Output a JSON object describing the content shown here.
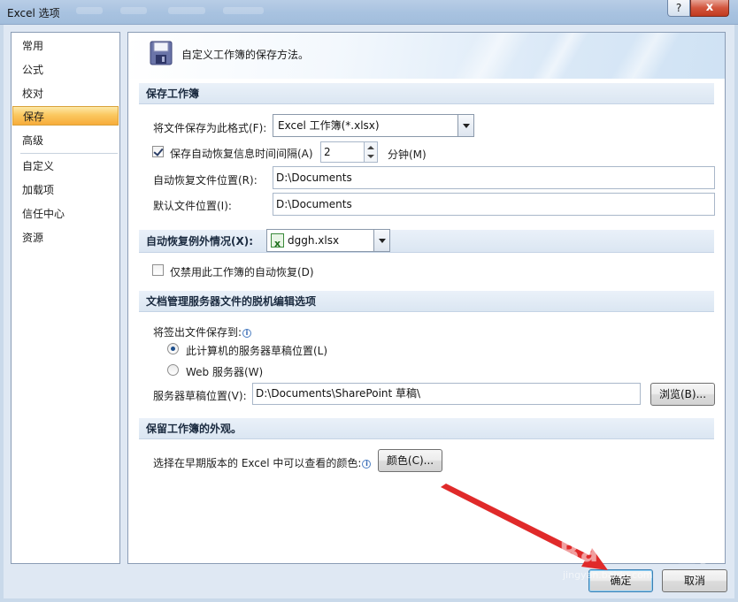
{
  "window": {
    "title": "Excel 选项",
    "help_label": "?",
    "close_label": "x"
  },
  "nav": {
    "items": [
      {
        "label": "常用"
      },
      {
        "label": "公式"
      },
      {
        "label": "校对"
      },
      {
        "label": "保存"
      },
      {
        "label": "高级"
      },
      {
        "label": "自定义"
      },
      {
        "label": "加载项"
      },
      {
        "label": "信任中心"
      },
      {
        "label": "资源"
      }
    ],
    "selected": "保存"
  },
  "banner": {
    "text": "自定义工作簿的保存方法。",
    "icon": "floppy-disk-icon"
  },
  "save_section": {
    "header": "保存工作簿",
    "format_label": "将文件保存为此格式(F):",
    "format_value": "Excel 工作簿(*.xlsx)",
    "autorecover_label": "保存自动恢复信息时间间隔(A)",
    "autorecover_checked": true,
    "autorecover_minutes": "2",
    "minutes_label": "分钟(M)",
    "autorecover_location_label": "自动恢复文件位置(R):",
    "autorecover_location_value": "D:\\Documents",
    "default_location_label": "默认文件位置(I):",
    "default_location_value": "D:\\Documents"
  },
  "exception_section": {
    "header": "自动恢复例外情况(X):",
    "workbook_value": "dggh.xlsx",
    "disable_label": "仅禁用此工作簿的自动恢复(D)",
    "disable_checked": false
  },
  "offline_section": {
    "header": "文档管理服务器文件的脱机编辑选项",
    "save_to_label": "将签出文件保存到:",
    "option_local": "此计算机的服务器草稿位置(L)",
    "option_web": "Web 服务器(W)",
    "selected_option": "local",
    "drafts_location_label": "服务器草稿位置(V):",
    "drafts_location_value": "D:\\Documents\\SharePoint 草稿\\",
    "browse_label": "浏览(B)..."
  },
  "appearance_section": {
    "header": "保留工作簿的外观。",
    "colors_label": "选择在早期版本的 Excel 中可以查看的颜色:",
    "colors_button": "颜色(C)..."
  },
  "footer": {
    "ok_label": "确定",
    "cancel_label": "取消"
  },
  "colors": {
    "selected_nav": "#f7ac3a",
    "annotation_arrow": "#e02a2a"
  }
}
